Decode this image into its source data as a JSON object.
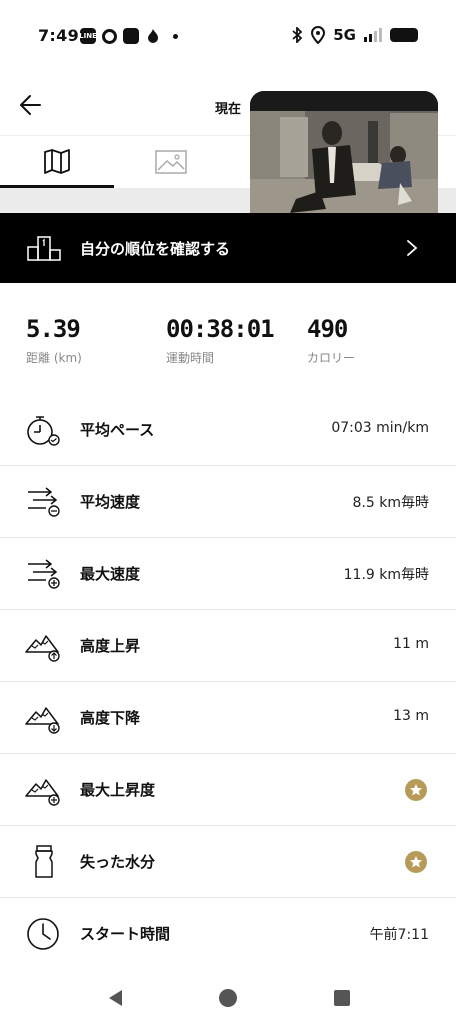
{
  "status_bar": {
    "time": "7:49",
    "left_icons": [
      "line-icon",
      "d-icon",
      "app-icon",
      "fire-icon",
      "dot-icon"
    ],
    "network": "5G",
    "right_icons": [
      "bluetooth-icon",
      "location-icon",
      "signal-icon",
      "battery-icon"
    ]
  },
  "header": {
    "back_icon": "back-arrow-icon",
    "now_label": "現在"
  },
  "tabs": [
    {
      "icon": "map-icon",
      "selected": true
    },
    {
      "icon": "photo-icon",
      "selected": false
    }
  ],
  "rank_banner": {
    "label": "自分の順位を確認する",
    "icon": "podium-icon",
    "chevron": "chevron-right-icon"
  },
  "summary": {
    "distance": {
      "value": "5.39",
      "label": "距離 (km)"
    },
    "duration": {
      "value": "00:38:01",
      "label": "運動時間"
    },
    "calories": {
      "value": "490",
      "label": "カロリー"
    }
  },
  "metrics": [
    {
      "label": "平均ペース",
      "value": "07:03 min/km",
      "icon": "stopwatch-icon"
    },
    {
      "label": "平均速度",
      "value": "8.5 km毎時",
      "icon": "speed-avg-icon"
    },
    {
      "label": "最大速度",
      "value": "11.9 km毎時",
      "icon": "speed-max-icon"
    },
    {
      "label": "高度上昇",
      "value": "11 m",
      "icon": "elevation-up-icon"
    },
    {
      "label": "高度下降",
      "value": "13 m",
      "icon": "elevation-down-icon"
    },
    {
      "label": "最大上昇度",
      "value": "",
      "icon": "elevation-max-icon",
      "premium": true
    },
    {
      "label": "失った水分",
      "value": "",
      "icon": "bottle-icon",
      "premium": true
    },
    {
      "label": "スタート時間",
      "value": "午前7:11",
      "icon": "clock-icon"
    }
  ],
  "colors": {
    "accent_gold": "#b79a57",
    "banner_bg": "#000000",
    "divider": "#e6e6e6"
  },
  "nav_bar": [
    "back-triangle-icon",
    "home-circle-icon",
    "recents-square-icon"
  ]
}
